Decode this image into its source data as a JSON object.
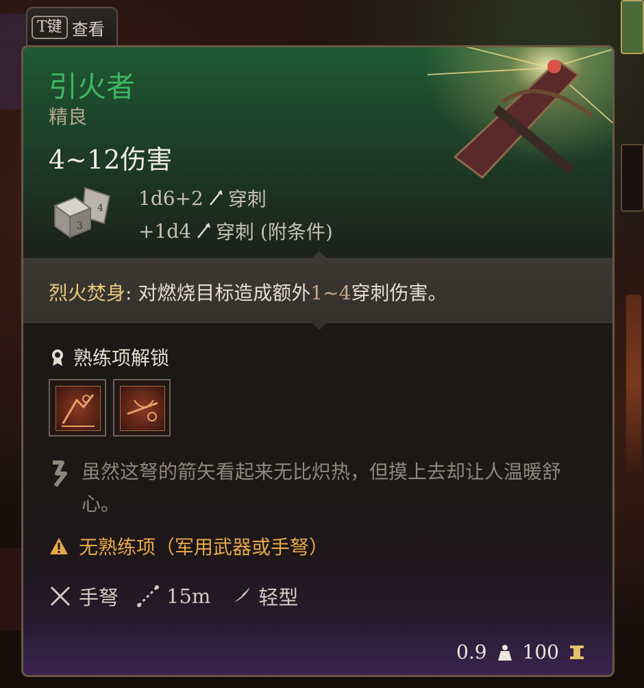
{
  "tab": {
    "key": "T键",
    "label": "查看"
  },
  "item": {
    "name": "引火者",
    "rarity": "精良",
    "damage": "4~12伤害",
    "damage_rows": [
      {
        "dice": "1d6+2",
        "type": "穿刺"
      },
      {
        "dice": "+1d4",
        "type": "穿刺 (附条件)"
      }
    ],
    "passive": {
      "name": "烈火焚身",
      "text_a": ": 对燃烧目标造成额外",
      "num": "1~4",
      "text_b": "穿刺伤害。"
    },
    "proficiency_unlock": "熟练项解锁",
    "flavor": "虽然这弩的箭矢看起来无比炽热，但摸上去却让人温暖舒心。",
    "warning": "无熟练项（军用武器或手弩）",
    "properties": [
      {
        "icon": "crossed-swords-icon",
        "label": "手弩"
      },
      {
        "icon": "range-icon",
        "label": "15m"
      },
      {
        "icon": "feather-icon",
        "label": "轻型"
      }
    ],
    "weight": "0.9",
    "value": "100"
  },
  "colors": {
    "name_green": "#3fb560",
    "passive_gold": "#e8c97a",
    "warning_orange": "#e6a84a",
    "border": "#6a5744"
  }
}
